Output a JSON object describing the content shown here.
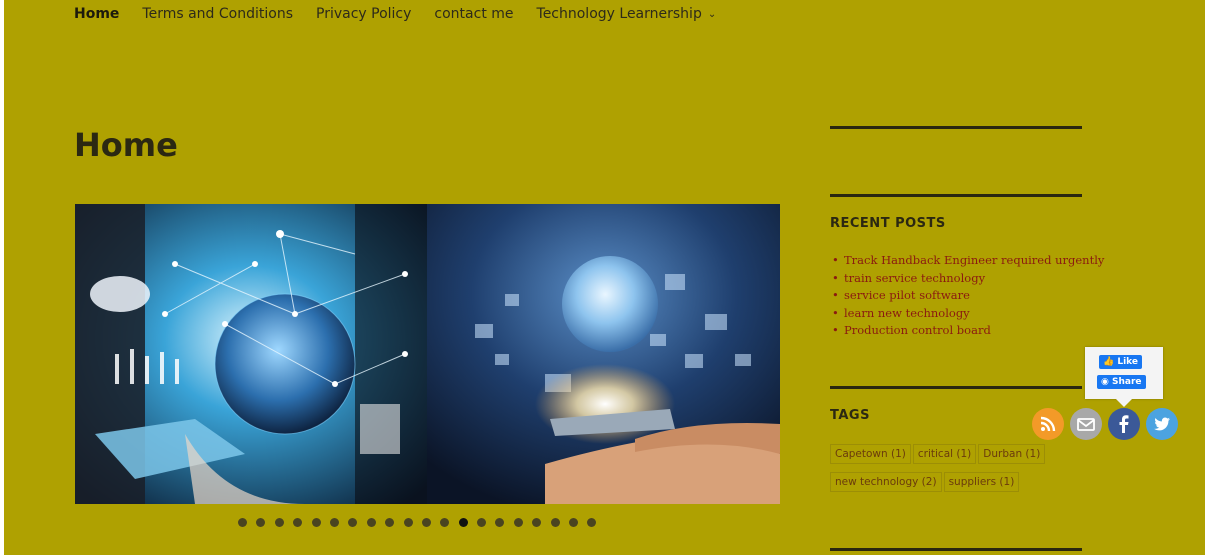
{
  "nav": {
    "items": [
      {
        "label": "Home"
      },
      {
        "label": "Terms and Conditions"
      },
      {
        "label": "Privacy Policy"
      },
      {
        "label": "contact me"
      },
      {
        "label": "Technology Learnership"
      }
    ]
  },
  "page": {
    "title": "Home"
  },
  "slider": {
    "dot_count": 20,
    "active_index": 12
  },
  "sidebar": {
    "recent_posts": {
      "title": "RECENT POSTS",
      "items": [
        "Track Handback Engineer required urgently",
        "train service technology",
        "service pilot software",
        "learn new technology",
        "Production control board"
      ]
    },
    "tags": {
      "title": "TAGS",
      "items": [
        "Capetown (1)",
        "critical (1)",
        "Durban (1)",
        "new technology (2)",
        "suppliers (1)"
      ]
    }
  },
  "social": {
    "like_label": "Like",
    "share_label": "Share",
    "icons": [
      "rss-icon",
      "email-icon",
      "facebook-icon",
      "twitter-icon"
    ]
  },
  "colors": {
    "background": "#afa101",
    "link": "#8b1a10",
    "text": "#2b2812"
  }
}
